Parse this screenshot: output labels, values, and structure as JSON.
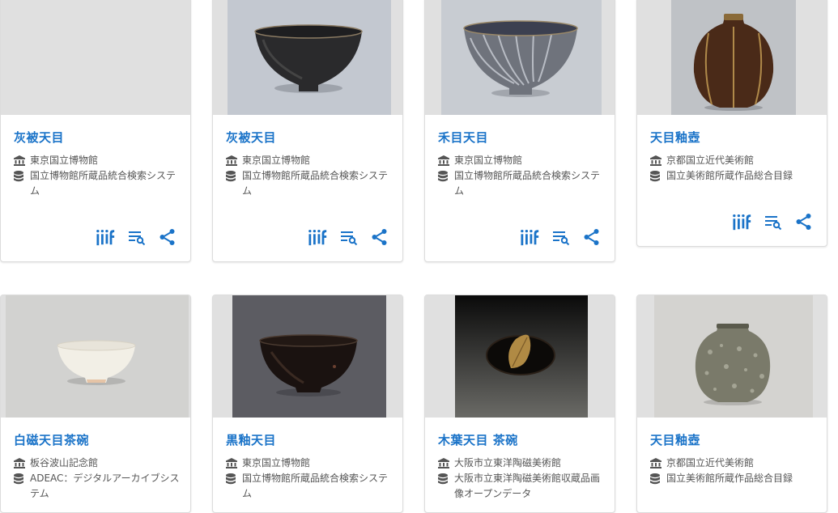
{
  "colors": {
    "accent": "#1a73c8",
    "text_meta": "#555555",
    "card_border": "#dcdcdc",
    "placeholder": "#e0e0e0"
  },
  "icons": {
    "institution": "bank-icon",
    "database": "database-icon",
    "iiif": "iiif-icon",
    "search": "list-search-icon",
    "share": "share-icon"
  },
  "cards": [
    {
      "title": "灰被天目",
      "org": "東京国立博物館",
      "source": "国立博物館所蔵品統合検索システム",
      "image": "placeholder-empty"
    },
    {
      "title": "灰被天目",
      "org": "東京国立博物館",
      "source": "国立博物館所蔵品統合検索システム",
      "image": "dark-tea-bowl"
    },
    {
      "title": "禾目天目",
      "org": "東京国立博物館",
      "source": "国立博物館所蔵品統合検索システム",
      "image": "hare-fur-tea-bowl"
    },
    {
      "title": "天目釉壺",
      "org": "京都国立近代美術館",
      "source": "国立美術館所蔵作品総合目録",
      "image": "brown-jar"
    },
    {
      "title": "白磁天目茶碗",
      "org": "板谷波山記念館",
      "source": "ADEAC：デジタルアーカイブシステム",
      "image": "white-bowl"
    },
    {
      "title": "黒釉天目",
      "org": "東京国立博物館",
      "source": "国立博物館所蔵品統合検索システム",
      "image": "black-bowl"
    },
    {
      "title": "木葉天目 茶碗",
      "org": "大阪市立東洋陶磁美術館",
      "source": "大阪市立東洋陶磁美術館収蔵品画像オープンデータ",
      "image": "leaf-bowl"
    },
    {
      "title": "天目釉壺",
      "org": "京都国立近代美術館",
      "source": "国立美術館所蔵作品総合目録",
      "image": "speckled-jar"
    }
  ]
}
